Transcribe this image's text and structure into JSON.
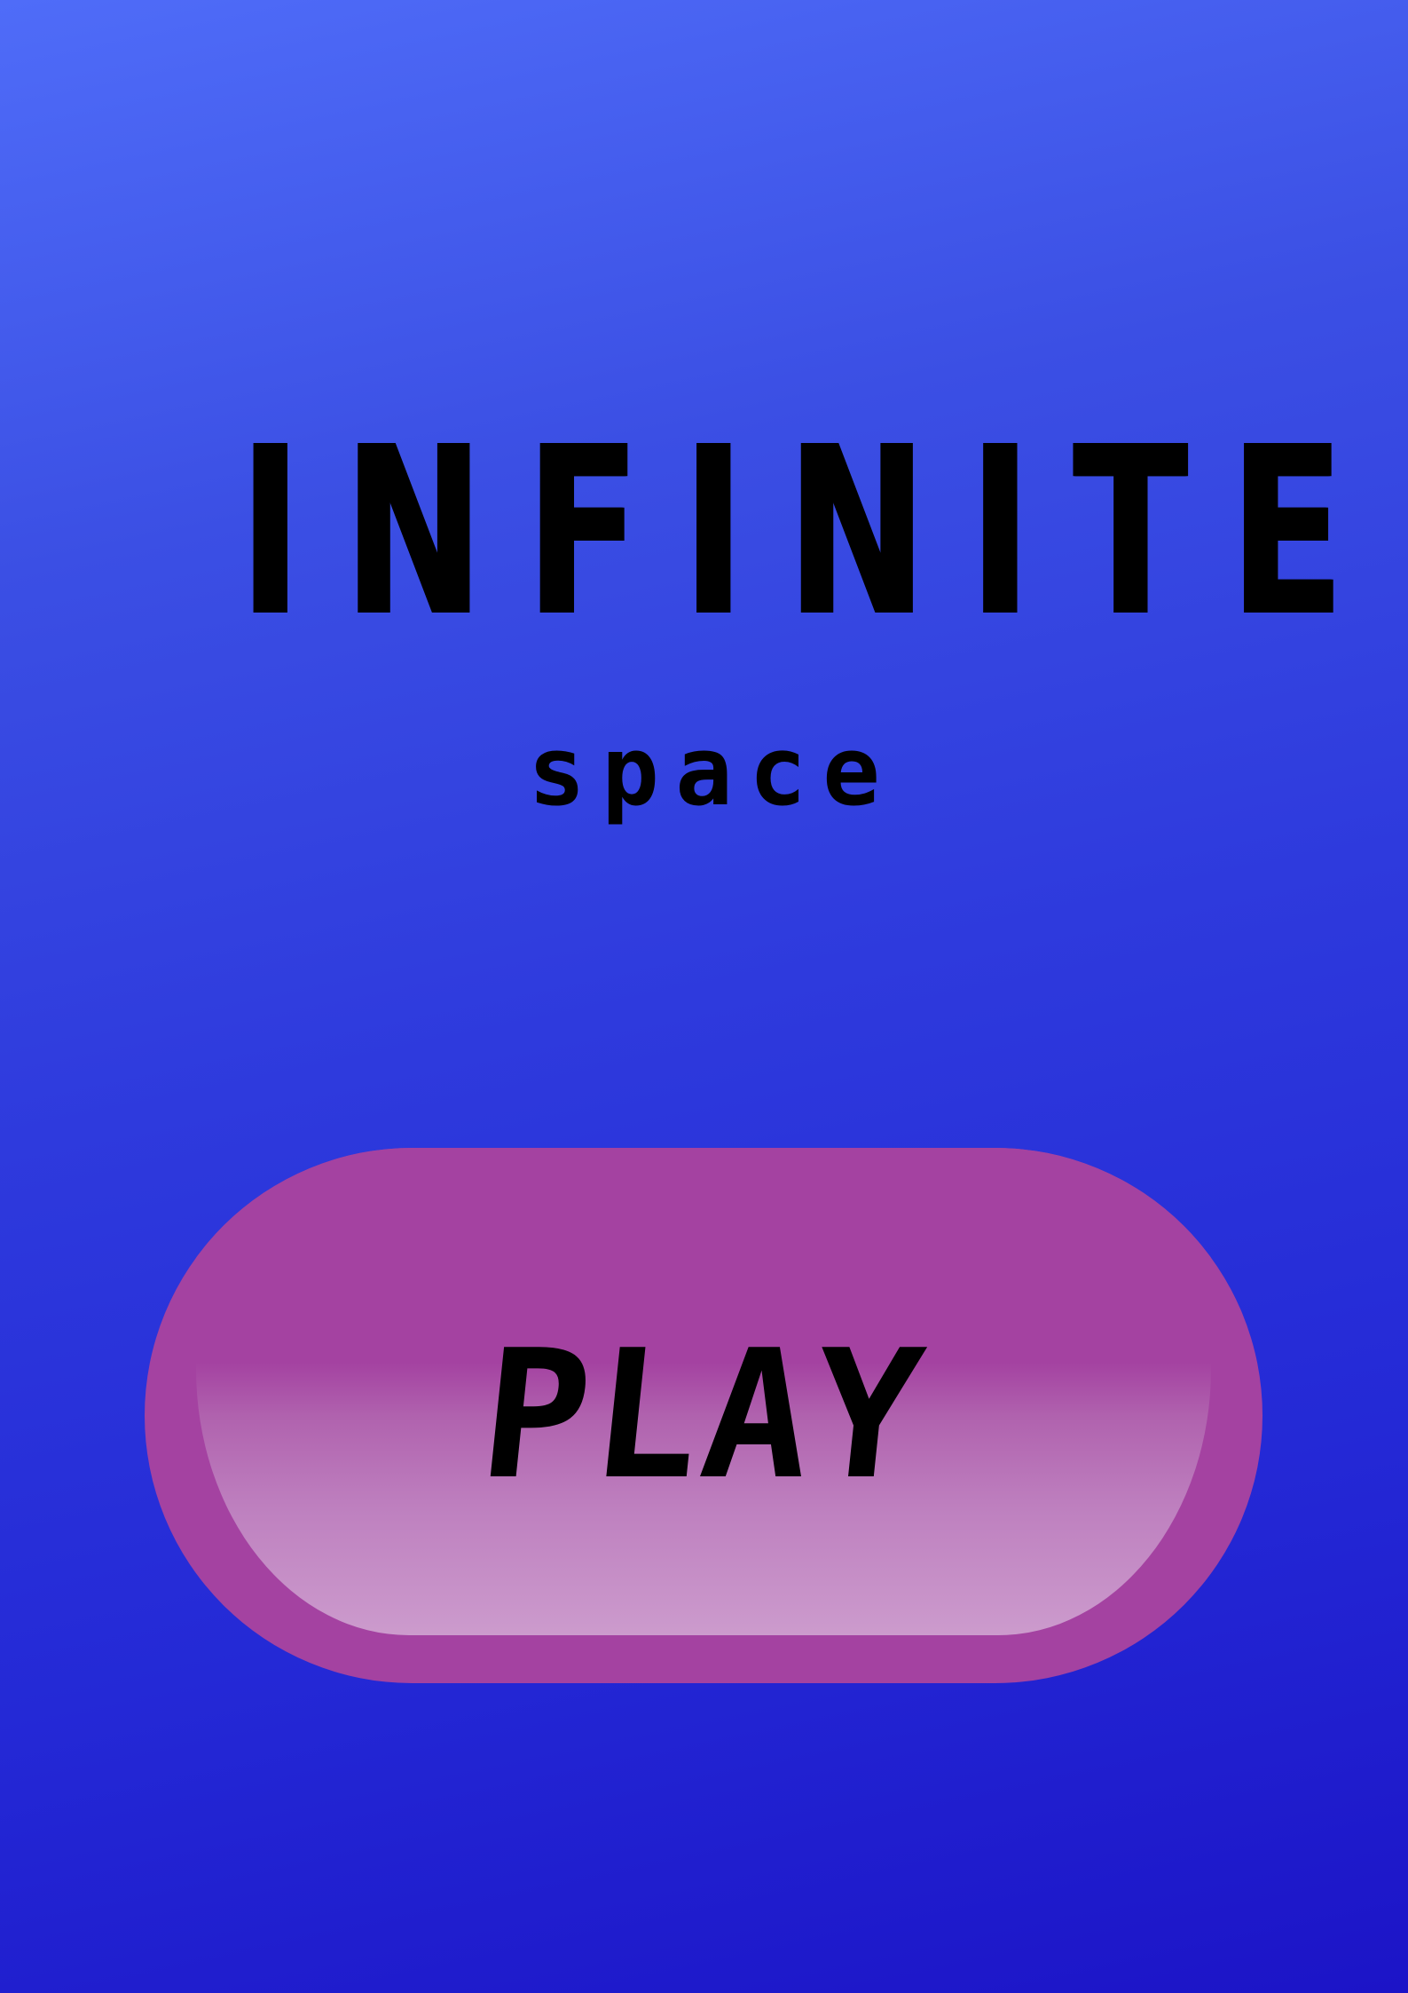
{
  "game": {
    "title": "INFINITE",
    "subtitle": "space"
  },
  "menu": {
    "play_label": "PLAY"
  },
  "colors": {
    "background_top": "#4f6cf8",
    "background_bottom": "#1c14c7",
    "button_fill": "#a442a1",
    "button_highlight": "#cc9bcd",
    "text": "#000000"
  }
}
